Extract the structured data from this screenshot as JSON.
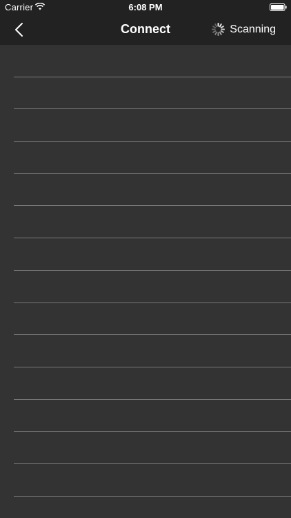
{
  "status_bar": {
    "carrier": "Carrier",
    "time": "6:08 PM",
    "icons": [
      "wifi-icon",
      "battery-icon"
    ]
  },
  "navbar": {
    "back_icon": "chevron-left-icon",
    "title": "Connect",
    "scanning_icon": "activity-spinner-icon",
    "scanning_label": "Scanning"
  },
  "colors": {
    "background": "#333333",
    "navbar": "#222222",
    "separator": "#7a7a7a",
    "text": "#ffffff"
  },
  "device_list": {
    "rows": [
      "",
      "",
      "",
      "",
      "",
      "",
      "",
      "",
      "",
      "",
      "",
      "",
      "",
      "",
      ""
    ]
  }
}
